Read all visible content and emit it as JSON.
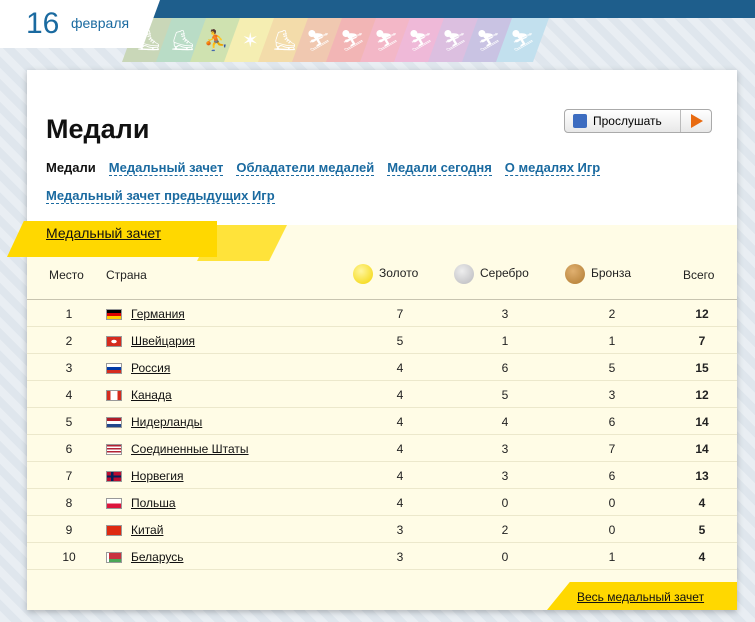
{
  "date": {
    "day": "16",
    "month": "февраля"
  },
  "sports_icons": [
    "curling-icon",
    "speed-skating-icon",
    "figure-skating-pairs-icon",
    "figure-skating-icon",
    "curling-stone-icon",
    "biathlon-icon",
    "cross-country-icon",
    "ski-jumping-icon",
    "hockey-icon",
    "alpine-skiing-icon",
    "freestyle-icon",
    "snowboard-icon"
  ],
  "sports_colors": [
    "#c9d7b8",
    "#b9dcc6",
    "#cfe2b0",
    "#f5eeb2",
    "#f3dcaa",
    "#f0c8b0",
    "#f2b5b5",
    "#f3b7c7",
    "#efb9d8",
    "#dcbfe0",
    "#c9c3e3",
    "#c2e0ee"
  ],
  "page": {
    "title": "Медали",
    "listen": "Прослушать"
  },
  "nav": [
    {
      "label": "Медали",
      "current": true
    },
    {
      "label": "Медальный зачет"
    },
    {
      "label": "Обладатели медалей"
    },
    {
      "label": "Медали сегодня"
    },
    {
      "label": "О медалях Игр"
    },
    {
      "label": "Медальный зачет предыдущих Игр"
    }
  ],
  "tab": "Медальный зачет",
  "columns": {
    "place": "Место",
    "country": "Страна",
    "gold": "Золото",
    "silver": "Серебро",
    "bronze": "Бронза",
    "total": "Всего"
  },
  "medal_colors": {
    "gold": "#f3d400",
    "silver": "#b8b8bc",
    "bronze": "#b07a30"
  },
  "rows": [
    {
      "place": "1",
      "country": "Германия",
      "flag": "de",
      "gold": "7",
      "silver": "3",
      "bronze": "2",
      "total": "12"
    },
    {
      "place": "2",
      "country": "Швейцария",
      "flag": "ch",
      "gold": "5",
      "silver": "1",
      "bronze": "1",
      "total": "7"
    },
    {
      "place": "3",
      "country": "Россия",
      "flag": "ru",
      "gold": "4",
      "silver": "6",
      "bronze": "5",
      "total": "15"
    },
    {
      "place": "4",
      "country": "Канада",
      "flag": "ca",
      "gold": "4",
      "silver": "5",
      "bronze": "3",
      "total": "12"
    },
    {
      "place": "5",
      "country": "Нидерланды",
      "flag": "nl",
      "gold": "4",
      "silver": "4",
      "bronze": "6",
      "total": "14"
    },
    {
      "place": "6",
      "country": "Соединенные Штаты",
      "flag": "us",
      "gold": "4",
      "silver": "3",
      "bronze": "7",
      "total": "14"
    },
    {
      "place": "7",
      "country": "Норвегия",
      "flag": "no",
      "gold": "4",
      "silver": "3",
      "bronze": "6",
      "total": "13"
    },
    {
      "place": "8",
      "country": "Польша",
      "flag": "pl",
      "gold": "4",
      "silver": "0",
      "bronze": "0",
      "total": "4"
    },
    {
      "place": "9",
      "country": "Китай",
      "flag": "cn",
      "gold": "3",
      "silver": "2",
      "bronze": "0",
      "total": "5"
    },
    {
      "place": "10",
      "country": "Беларусь",
      "flag": "by",
      "gold": "3",
      "silver": "0",
      "bronze": "1",
      "total": "4"
    }
  ],
  "footer_link": "Весь медальный зачет"
}
